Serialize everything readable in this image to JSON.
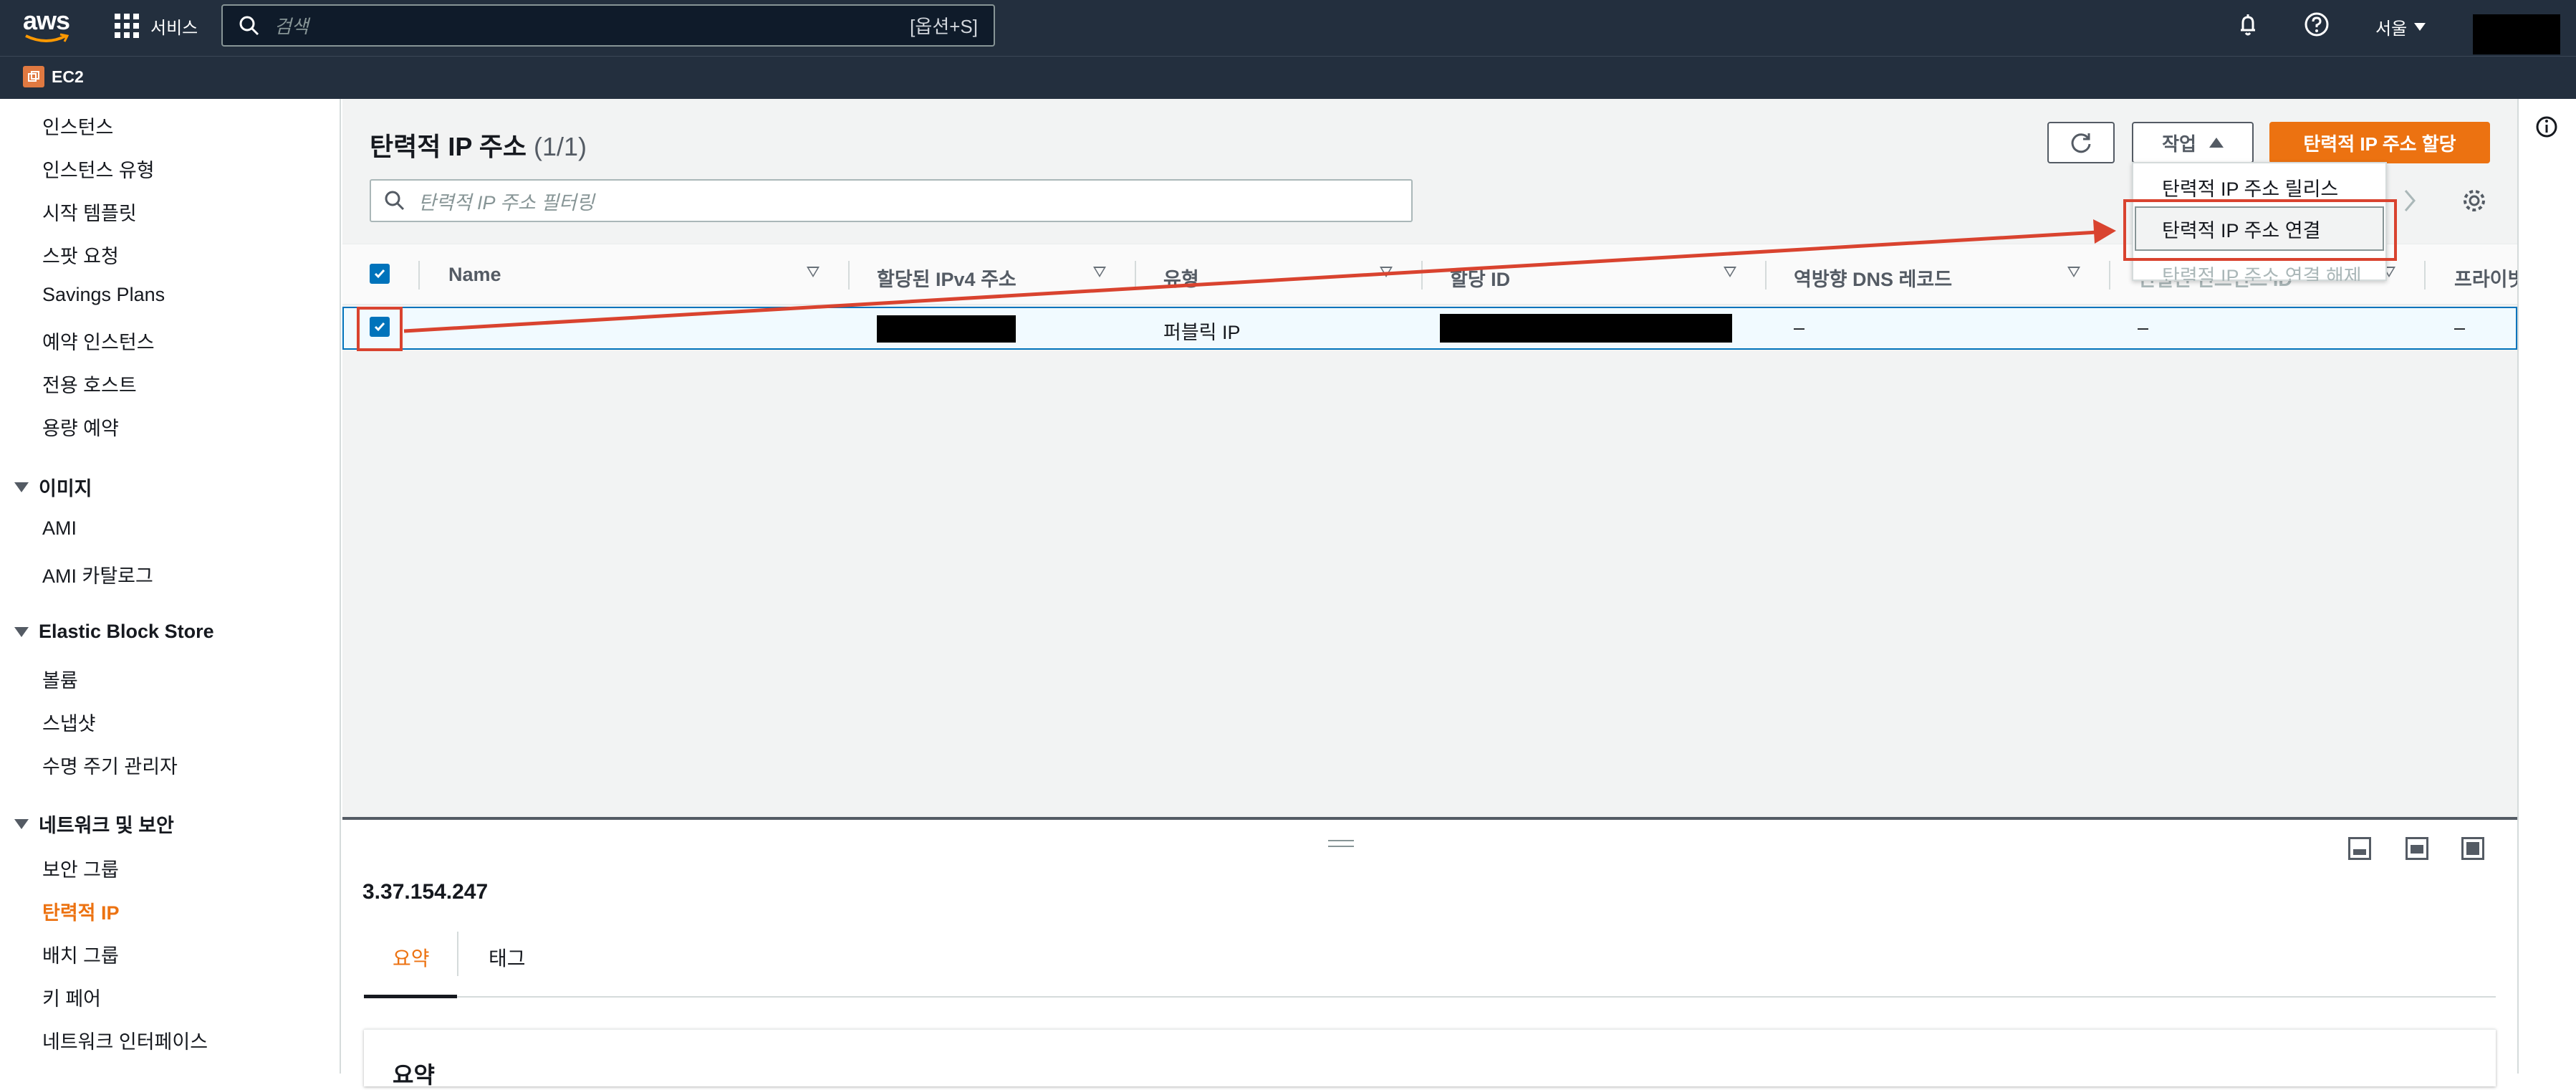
{
  "topnav": {
    "logo": "aws",
    "services_label": "서비스",
    "search_placeholder": "검색",
    "search_shortcut": "[옵션+S]",
    "region_label": "서울",
    "service_tag": "EC2"
  },
  "sidebar": {
    "top_items": [
      "인스턴스",
      "인스턴스 유형",
      "시작 템플릿",
      "스팟 요청",
      "Savings Plans",
      "예약 인스턴스",
      "전용 호스트",
      "용량 예약"
    ],
    "sections": [
      {
        "title": "이미지",
        "items": [
          "AMI",
          "AMI 카탈로그"
        ]
      },
      {
        "title": "Elastic Block Store",
        "items": [
          "볼륨",
          "스냅샷",
          "수명 주기 관리자"
        ]
      },
      {
        "title": "네트워크 및 보안",
        "items": [
          "보안 그룹",
          "탄력적 IP",
          "배치 그룹",
          "키 페어",
          "네트워크 인터페이스"
        ]
      }
    ],
    "active_item": "탄력적 IP"
  },
  "panel": {
    "title": "탄력적 IP 주소",
    "count": "(1/1)",
    "actions_label": "작업",
    "allocate_label": "탄력적 IP 주소 할당",
    "filter_placeholder": "탄력적 IP 주소 필터링"
  },
  "dropdown": {
    "items": [
      "탄력적 IP 주소 릴리스",
      "탄력적 IP 주소 연결",
      "탄력적 IP 주소 연결 해제"
    ]
  },
  "table": {
    "columns": [
      "Name",
      "할당된 IPv4 주소",
      "유형",
      "할당 ID",
      "역방향 DNS 레코드",
      "연결된 인스턴스 ID",
      "프라이빗"
    ],
    "rows": [
      {
        "name": "–",
        "type": "퍼블릭 IP",
        "reverse_dns": "–",
        "instance": "–",
        "private": "–"
      }
    ]
  },
  "details": {
    "ip": "3.37.154.247",
    "tabs": [
      "요약",
      "태그"
    ],
    "summary_heading": "요약"
  },
  "colors": {
    "nav_bg": "#232f3e",
    "accent_orange": "#ec7211",
    "selection_blue": "#0073bb",
    "annotation_red": "#d9432f"
  }
}
